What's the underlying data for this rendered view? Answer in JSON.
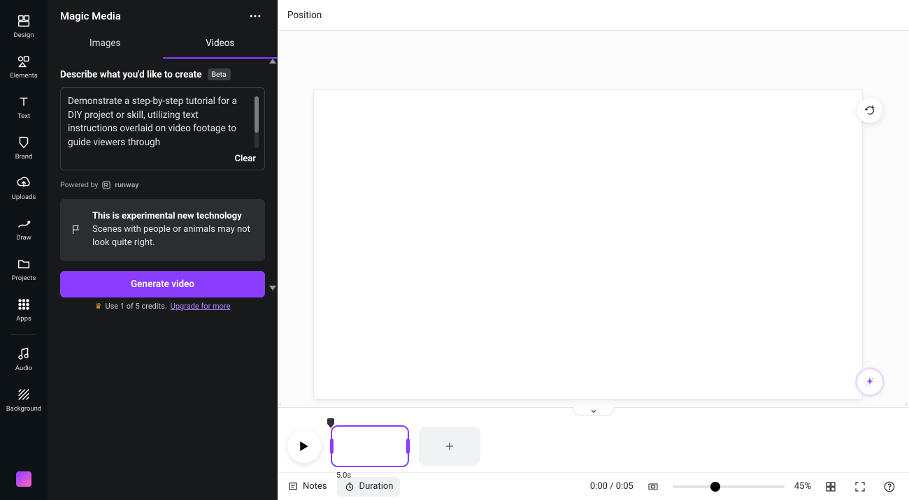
{
  "rail": {
    "items": [
      {
        "label": "Design"
      },
      {
        "label": "Elements"
      },
      {
        "label": "Text"
      },
      {
        "label": "Brand"
      },
      {
        "label": "Uploads"
      },
      {
        "label": "Draw"
      },
      {
        "label": "Projects"
      },
      {
        "label": "Apps"
      }
    ],
    "extra": [
      {
        "label": "Audio"
      },
      {
        "label": "Background"
      }
    ]
  },
  "panel": {
    "title": "Magic Media",
    "tabs": {
      "images": "Images",
      "videos": "Videos",
      "active": "videos"
    },
    "describeLabel": "Describe what you'd like to create",
    "betaLabel": "Beta",
    "promptValue": "Demonstrate a step-by-step tutorial for a DIY project or skill, utilizing text instructions overlaid on video footage to guide viewers through",
    "clearLabel": "Clear",
    "poweredByLabel": "Powered by",
    "poweredByBrand": "runway",
    "infoTitle": "This is experimental new technology",
    "infoBody": "Scenes with people or animals may not look quite right.",
    "generateLabel": "Generate video",
    "creditsText": "Use 1 of 5 credits.",
    "upgradeText": "Upgrade for more"
  },
  "topbar": {
    "position": "Position"
  },
  "timeline": {
    "clipDuration": "5.0s"
  },
  "bottombar": {
    "notes": "Notes",
    "duration": "Duration",
    "time": "0:00 / 0:05",
    "zoom": "45%"
  },
  "colors": {
    "accent": "#8b3dff"
  }
}
